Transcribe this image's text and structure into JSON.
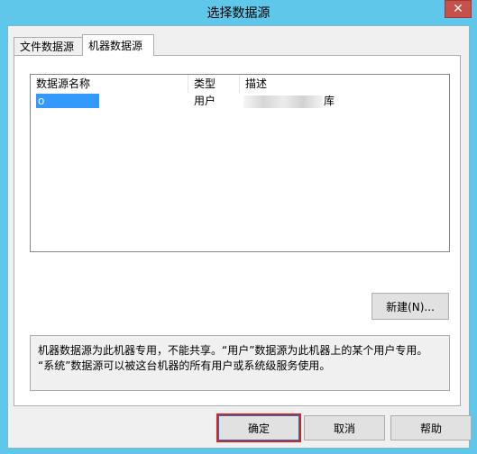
{
  "window": {
    "title": "选择数据源",
    "close_glyph": "✕"
  },
  "tabs": [
    {
      "label": "文件数据源"
    },
    {
      "label": "机器数据源"
    }
  ],
  "listview": {
    "columns": [
      "数据源名称",
      "类型",
      "描述"
    ],
    "rows": [
      {
        "name_prefix": "o",
        "type": "用户",
        "desc_suffix": "库"
      }
    ]
  },
  "buttons": {
    "new": "新建(N)...",
    "ok": "确定",
    "cancel": "取消",
    "help": "帮助"
  },
  "info": {
    "line1": "机器数据源为此机器专用，不能共享。“用户”数据源为此机器上的某个用户专用。",
    "line2": "“系统”数据源可以被这台机器的所有用户或系统级服务使用。"
  },
  "colors": {
    "titlebar": "#5fc7ea",
    "selection": "#3399ff",
    "close": "#c7504b",
    "highlight_ring": "#e2231a"
  }
}
